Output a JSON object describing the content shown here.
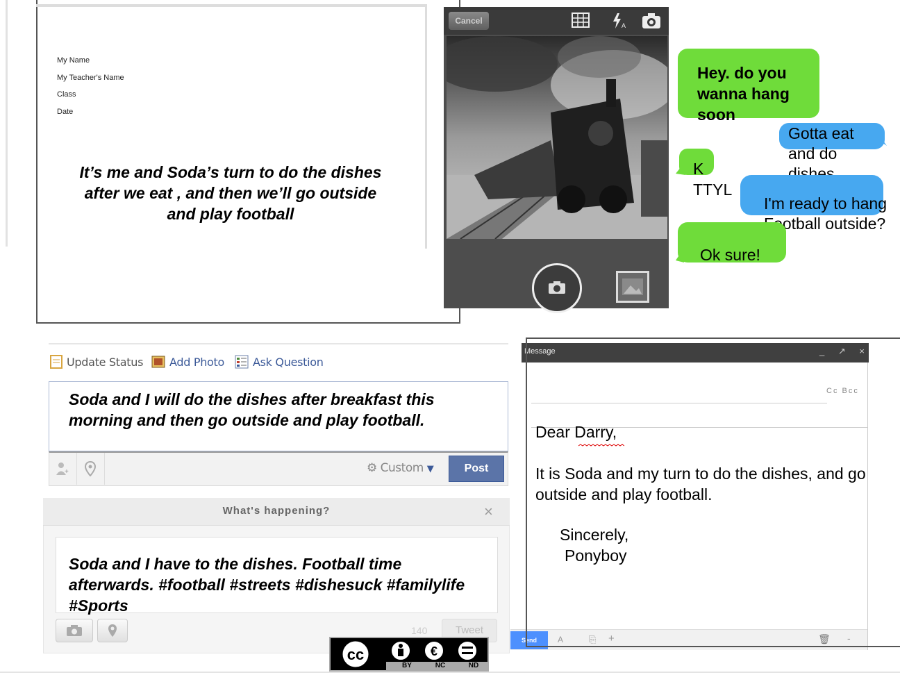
{
  "document": {
    "fields": [
      "My Name",
      "My Teacher's Name",
      "Class",
      "Date"
    ],
    "body": "It’s me and Soda’s turn to do the dishes after we eat , and then we’ll go outside and play football"
  },
  "camera": {
    "cancel_label": "Cancel",
    "icons": [
      "grid-icon",
      "flash-auto-icon",
      "switch-camera-icon"
    ]
  },
  "messages": [
    {
      "side": "left",
      "color": "green",
      "text": "Hey. do you wanna hang soon"
    },
    {
      "side": "right",
      "color": "blue",
      "text": "Gotta eat and do dishes"
    },
    {
      "side": "left",
      "color": "green",
      "text": "K TTYL"
    },
    {
      "side": "right",
      "color": "blue",
      "text": "I'm ready to hang Football outside?"
    },
    {
      "side": "left",
      "color": "green",
      "text": "Ok sure!"
    }
  ],
  "facebook": {
    "tabs": [
      "Update Status",
      "Add Photo",
      "Ask Question"
    ],
    "status_text": "Soda and I will do the dishes after breakfast this morning and then go outside and play football.",
    "privacy_label": "Custom",
    "post_label": "Post"
  },
  "twitter": {
    "title": "What's happening?",
    "close_label": "×",
    "tweet_text": "Soda and I have to the dishes. Football time afterwards. #football #streets #dishesuck #familylife #Sports",
    "char_count": "140",
    "tweet_label": "Tweet"
  },
  "email": {
    "window_title": "Message",
    "window_controls": "_ ↗ ×",
    "cc_bcc": "Cc Bcc",
    "greeting": "Dear Darry,",
    "body": "It is Soda and my turn to do the dishes, and go outside and play football.",
    "closing": "Sincerely,",
    "signature": "Ponyboy",
    "send_label": "Send"
  },
  "license_badge": {
    "labels": [
      "BY",
      "NC",
      "ND"
    ]
  },
  "colors": {
    "imessage_green": "#6fdc3a",
    "imessage_blue": "#47a8f0",
    "facebook_blue": "#3b5998",
    "gmail_send_blue": "#4d90fe"
  }
}
